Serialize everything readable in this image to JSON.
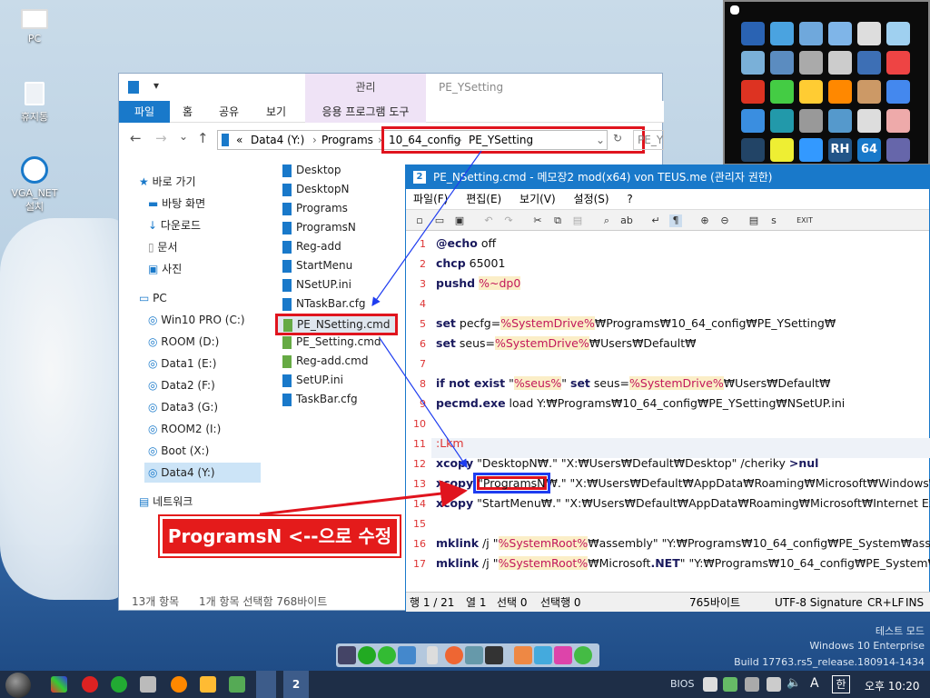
{
  "desktop": {
    "icons": [
      {
        "label": "PC"
      },
      {
        "label": "휴지통"
      },
      {
        "label": "VGA_NET\n설치"
      }
    ],
    "watermark": [
      "테스트 모드",
      "Windows 10 Enterprise",
      "Build 17763.rs5_release.180914-1434"
    ]
  },
  "explorer": {
    "manage_label": "관리",
    "window_title": "PE_YSetting",
    "tabs": [
      "파일",
      "홈",
      "공유",
      "보기",
      "응용 프로그램 도구"
    ],
    "address": {
      "prefix": "«",
      "segments": [
        "Data4 (Y:)",
        "Programs",
        "10_64_config",
        "PE_YSetting"
      ]
    },
    "search_placeholder": "PE_YSetting 검색",
    "nav": [
      {
        "label": "바로 가기"
      },
      {
        "label": "바탕 화면"
      },
      {
        "label": "다운로드"
      },
      {
        "label": "문서"
      },
      {
        "label": "사진"
      },
      {
        "label": "PC"
      },
      {
        "label": "Win10 PRO (C:)"
      },
      {
        "label": "ROOM (D:)"
      },
      {
        "label": "Data1 (E:)"
      },
      {
        "label": "Data2 (F:)"
      },
      {
        "label": "Data3 (G:)"
      },
      {
        "label": "ROOM2 (I:)"
      },
      {
        "label": "Boot (X:)"
      },
      {
        "label": "Data4 (Y:)"
      },
      {
        "label": "네트워크"
      }
    ],
    "files": [
      "Desktop",
      "DesktopN",
      "Programs",
      "ProgramsN",
      "Reg-add",
      "StartMenu",
      "NSetUP.ini",
      "NTaskBar.cfg",
      "PE_NSetting.cmd",
      "PE_Setting.cmd",
      "Reg-add.cmd",
      "SetUP.ini",
      "TaskBar.cfg"
    ],
    "status_count": "13개 항목",
    "status_selected": "1개 항목 선택함 768바이트"
  },
  "notepad": {
    "title": "PE_NSetting.cmd - 메모장2 mod(x64) von TEUS.me (관리자 권한)",
    "menu": [
      "파일(F)",
      "편집(E)",
      "보기(V)",
      "설정(S)",
      "?"
    ],
    "toolbar_exit": "EXIT",
    "lines": [
      {
        "n": "1",
        "text": "@echo off"
      },
      {
        "n": "2",
        "text": "chcp 65001"
      },
      {
        "n": "3",
        "text": "pushd %~dp0"
      },
      {
        "n": "4",
        "text": ""
      },
      {
        "n": "5",
        "text": "set pecfg=%SystemDrive%₩Programs₩10_64_config₩PE_YSetting₩"
      },
      {
        "n": "6",
        "text": "set seus=%SystemDrive%₩Users₩Default₩"
      },
      {
        "n": "7",
        "text": ""
      },
      {
        "n": "8",
        "text": "if not exist \"%seus%\" set seus=%SystemDrive%₩Users₩Default₩"
      },
      {
        "n": "9",
        "text": "pecmd.exe load Y:₩Programs₩10_64_config₩PE_YSetting₩NSetUP.ini"
      },
      {
        "n": "10",
        "text": ""
      },
      {
        "n": "11",
        "text": ":Lkm"
      },
      {
        "n": "12",
        "text": "xcopy \"DesktopN₩.\" \"X:₩Users₩Default₩Desktop\" /cheriky >nul"
      },
      {
        "n": "13",
        "text": "xcopy \"ProgramsN₩.\" \"X:₩Users₩Default₩AppData₩Roaming₩Microsoft₩Windows₩Star"
      },
      {
        "n": "14",
        "text": "xcopy \"StartMenu₩.\" \"X:₩Users₩Default₩AppData₩Roaming₩Microsoft₩Internet Explore"
      },
      {
        "n": "15",
        "text": ""
      },
      {
        "n": "16",
        "text": "mklink /j \"%SystemRoot%₩assembly\" \"Y:₩Programs₩10_64_config₩PE_System₩assembly"
      },
      {
        "n": "17",
        "text": "mklink /j \"%SystemRoot%₩Microsoft.NET\" \"Y:₩Programs₩10_64_config₩PE_System₩Micr"
      }
    ],
    "status": {
      "position": "행 1 / 21",
      "column": "열 1",
      "selection": "선택 0",
      "selected_lines": "선택행 0",
      "size": "765바이트",
      "encoding": "UTF-8 Signature",
      "eol": "CR+LF",
      "mode": "INS"
    }
  },
  "annotation": {
    "callout": "ProgramsN <--으로 수정"
  },
  "taskbar": {
    "bios": "BIOS",
    "ime": "A",
    "lang": "한",
    "time": "오후 10:20"
  },
  "colors": {
    "accent": "#1979ca",
    "annotation_red": "#e0141e",
    "annotation_blue": "#1e3cf0"
  }
}
